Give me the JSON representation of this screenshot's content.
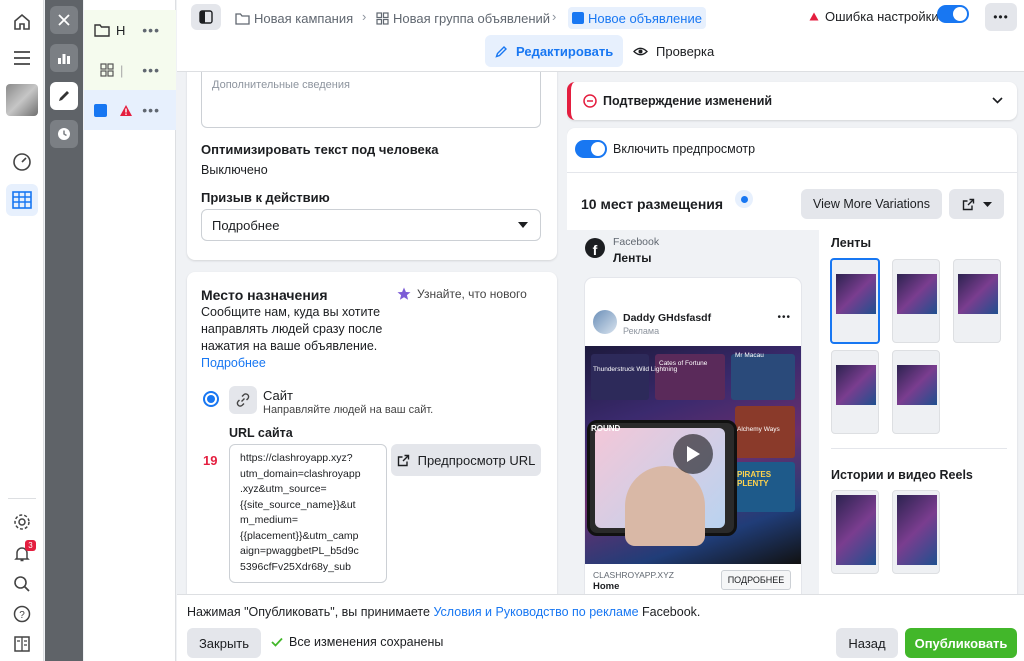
{
  "breadcrumb": {
    "campaign": "Новая кампания",
    "adset": "Новая группа объявлений",
    "ad": "Новое объявление"
  },
  "status": {
    "error_label": "Ошибка настройки"
  },
  "tabs": {
    "edit": "Редактировать",
    "review": "Проверка"
  },
  "tree": {
    "row1_label": "Н",
    "row2_label": "|"
  },
  "form": {
    "extra_info_placeholder": "Дополнительные сведения",
    "optimize_text_label": "Оптимизировать текст под человека",
    "optimize_text_value": "Выключено",
    "cta_label": "Призыв к действию",
    "cta_value": "Подробнее",
    "destination_title": "Место назначения",
    "whats_new": "Узнайте, что нового",
    "destination_desc_1": "Сообщите нам, куда вы хотите",
    "destination_desc_2": "направлять людей сразу после",
    "destination_desc_3": "нажатия на ваше объявление.",
    "learn_more": "Подробнее",
    "site_label": "Сайт",
    "site_desc": "Направляйте людей на ваш сайт.",
    "url_label": "URL сайта",
    "url_char_count": "19",
    "url_lines": [
      "https://clashroyapp.xyz?",
      "utm_domain=clashroyapp",
      ".xyz&utm_source=",
      "{{site_source_name}}&ut",
      "m_medium=",
      "{{placement}}&utm_camp",
      "aign=pwaggbetPL_b5d9c",
      "5396cfFv25Xdr68y_sub"
    ],
    "preview_url": "Предпросмотр URL"
  },
  "preview": {
    "confirm_changes": "Подтверждение изменений",
    "enable_preview": "Включить предпросмотр",
    "placements_count": "10 мест размещения",
    "view_more": "View More Variations",
    "platform": "Facebook",
    "feed": "Ленты",
    "page_name": "Daddy GHdsfasdf",
    "sponsored": "Реклама",
    "domain": "CLASHROYAPP.XYZ",
    "headline": "Home",
    "ad_cta": "ПОДРОБНЕЕ",
    "feeds_section": "Ленты",
    "stories_section": "Истории и видео Reels",
    "game_labels": [
      "Thunderstruck Wild Lightning",
      "Cates of Fortune",
      "Mr Macau",
      "Alchemy Ways",
      "PIRATES PLENTY",
      "ROUND"
    ]
  },
  "bottom": {
    "terms_prefix": "Нажимая \"Опубликовать\", вы принимаете ",
    "terms_link": "Условия и Руководство по рекламе",
    "terms_suffix": " Facebook.",
    "close": "Закрыть",
    "saved": "Все изменения сохранены",
    "back": "Назад",
    "publish": "Опубликовать"
  },
  "colors": {
    "accent": "#1877f2",
    "publish": "#42b72a",
    "error": "#e41e3f"
  }
}
